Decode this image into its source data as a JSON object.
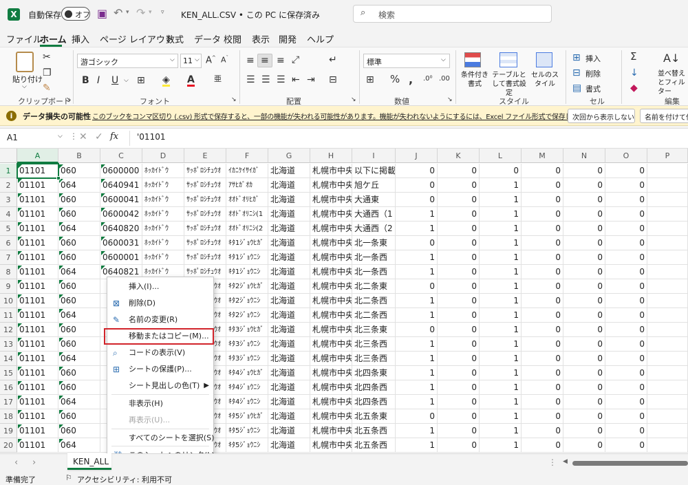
{
  "titlebar": {
    "autosave_label": "自動保存",
    "autosave_state": "オフ",
    "filename": "KEN_ALL.CSV • この PC に保存済み",
    "search_placeholder": "検索"
  },
  "menu": [
    "ファイル",
    "ホーム",
    "挿入",
    "ページ レイアウト",
    "数式",
    "データ",
    "校閲",
    "表示",
    "開発",
    "ヘルプ"
  ],
  "ribbon": {
    "clipboard": {
      "paste": "貼り付け",
      "group": "クリップボード"
    },
    "font": {
      "name": "游ゴシック",
      "size": "11",
      "group": "フォント"
    },
    "alignment": {
      "group": "配置"
    },
    "number": {
      "format": "標準",
      "group": "数値"
    },
    "styles": {
      "cond_format": "条件付き書式",
      "table_format": "テーブルとして書式設定",
      "cell_styles": "セルのスタイル",
      "group": "スタイル"
    },
    "cells": {
      "insert": "挿入",
      "delete": "削除",
      "format": "書式",
      "group": "セル"
    },
    "editing": {
      "sort": "並べ替えとフィルター",
      "group": "編集"
    }
  },
  "message_bar": {
    "title": "データ損失の可能性",
    "text": "このブックをコンマ区切り (.csv) 形式で保存すると、一部の機能が失われる可能性があります。機能が失われないようにするには、Excel ファイル形式で保存してください。",
    "btn_dont_show": "次回から表示しない",
    "btn_save_as": "名前を付けて保"
  },
  "formula_bar": {
    "name_box": "A1",
    "fx": "fx",
    "value": "'01101"
  },
  "columns": [
    "A",
    "B",
    "C",
    "D",
    "E",
    "F",
    "G",
    "H",
    "I",
    "J",
    "K",
    "L",
    "M",
    "N",
    "O",
    "P"
  ],
  "rows": [
    [
      "1",
      "01101",
      "060",
      "0600000",
      "ﾎｯｶｲﾄﾞｳ",
      "ｻｯﾎﾟﾛｼﾁｭｳｵ",
      "ｲｶﾆｹｲｻｲｶﾞ",
      "北海道",
      "札幌市中央",
      "以下に掲載",
      "0",
      "0",
      "0",
      "0",
      "0",
      "0"
    ],
    [
      "2",
      "01101",
      "064",
      "0640941",
      "ﾎｯｶｲﾄﾞｳ",
      "ｻｯﾎﾟﾛｼﾁｭｳｵ",
      "ｱｻﾋｶﾞｵｶ",
      "北海道",
      "札幌市中央",
      "旭ケ丘",
      "0",
      "0",
      "1",
      "0",
      "0",
      "0"
    ],
    [
      "3",
      "01101",
      "060",
      "0600041",
      "ﾎｯｶｲﾄﾞｳ",
      "ｻｯﾎﾟﾛｼﾁｭｳｵ",
      "ｵｵﾄﾞｵﾘﾋｶﾞ",
      "北海道",
      "札幌市中央",
      "大通東",
      "0",
      "0",
      "1",
      "0",
      "0",
      "0"
    ],
    [
      "4",
      "01101",
      "060",
      "0600042",
      "ﾎｯｶｲﾄﾞｳ",
      "ｻｯﾎﾟﾛｼﾁｭｳｵ",
      "ｵｵﾄﾞｵﾘﾆｼ(1",
      "北海道",
      "札幌市中央",
      "大通西（1",
      "1",
      "0",
      "1",
      "0",
      "0",
      "0"
    ],
    [
      "5",
      "01101",
      "064",
      "0640820",
      "ﾎｯｶｲﾄﾞｳ",
      "ｻｯﾎﾟﾛｼﾁｭｳｵ",
      "ｵｵﾄﾞｵﾘﾆｼ(2",
      "北海道",
      "札幌市中央",
      "大通西（2",
      "1",
      "0",
      "1",
      "0",
      "0",
      "0"
    ],
    [
      "6",
      "01101",
      "060",
      "0600031",
      "ﾎｯｶｲﾄﾞｳ",
      "ｻｯﾎﾟﾛｼﾁｭｳｵ",
      "ｷﾀ1ｼﾞｮｳﾋｶﾞ",
      "北海道",
      "札幌市中央",
      "北一条東",
      "0",
      "0",
      "1",
      "0",
      "0",
      "0"
    ],
    [
      "7",
      "01101",
      "060",
      "0600001",
      "ﾎｯｶｲﾄﾞｳ",
      "ｻｯﾎﾟﾛｼﾁｭｳｵ",
      "ｷﾀ1ｼﾞｮｳﾆｼ",
      "北海道",
      "札幌市中央",
      "北一条西",
      "1",
      "0",
      "1",
      "0",
      "0",
      "0"
    ],
    [
      "8",
      "01101",
      "064",
      "0640821",
      "ﾎｯｶｲﾄﾞｳ",
      "ｻｯﾎﾟﾛｼﾁｭｳｵ",
      "ｷﾀ1ｼﾞｮｳﾆｼ",
      "北海道",
      "札幌市中央",
      "北一条西",
      "1",
      "0",
      "1",
      "0",
      "0",
      "0"
    ],
    [
      "9",
      "01101",
      "060",
      "",
      "",
      "ｻｯﾎﾟﾛｼﾁｭｳｵ",
      "ｷﾀ2ｼﾞｮｳﾋｶﾞ",
      "北海道",
      "札幌市中央",
      "北二条東",
      "0",
      "0",
      "1",
      "0",
      "0",
      "0"
    ],
    [
      "10",
      "01101",
      "060",
      "",
      "",
      "ｻｯﾎﾟﾛｼﾁｭｳｵ",
      "ｷﾀ2ｼﾞｮｳﾆｼ",
      "北海道",
      "札幌市中央",
      "北二条西",
      "1",
      "0",
      "1",
      "0",
      "0",
      "0"
    ],
    [
      "11",
      "01101",
      "064",
      "",
      "",
      "ｻｯﾎﾟﾛｼﾁｭｳｵ",
      "ｷﾀ2ｼﾞｮｳﾆｼ",
      "北海道",
      "札幌市中央",
      "北二条西",
      "1",
      "0",
      "1",
      "0",
      "0",
      "0"
    ],
    [
      "12",
      "01101",
      "060",
      "",
      "",
      "ｻｯﾎﾟﾛｼﾁｭｳｵ",
      "ｷﾀ3ｼﾞｮｳﾋｶﾞ",
      "北海道",
      "札幌市中央",
      "北三条東",
      "0",
      "0",
      "1",
      "0",
      "0",
      "0"
    ],
    [
      "13",
      "01101",
      "060",
      "",
      "",
      "ｻｯﾎﾟﾛｼﾁｭｳｵ",
      "ｷﾀ3ｼﾞｮｳﾆｼ",
      "北海道",
      "札幌市中央",
      "北三条西",
      "1",
      "0",
      "1",
      "0",
      "0",
      "0"
    ],
    [
      "14",
      "01101",
      "064",
      "",
      "",
      "ｻｯﾎﾟﾛｼﾁｭｳｵ",
      "ｷﾀ3ｼﾞｮｳﾆｼ",
      "北海道",
      "札幌市中央",
      "北三条西",
      "1",
      "0",
      "1",
      "0",
      "0",
      "0"
    ],
    [
      "15",
      "01101",
      "060",
      "",
      "",
      "ｻｯﾎﾟﾛｼﾁｭｳｵ",
      "ｷﾀ4ｼﾞｮｳﾋｶﾞ",
      "北海道",
      "札幌市中央",
      "北四条東",
      "1",
      "0",
      "1",
      "0",
      "0",
      "0"
    ],
    [
      "16",
      "01101",
      "060",
      "",
      "",
      "ｻｯﾎﾟﾛｼﾁｭｳｵ",
      "ｷﾀ4ｼﾞｮｳﾆｼ",
      "北海道",
      "札幌市中央",
      "北四条西",
      "1",
      "0",
      "1",
      "0",
      "0",
      "0"
    ],
    [
      "17",
      "01101",
      "064",
      "",
      "",
      "ｻｯﾎﾟﾛｼﾁｭｳｵ",
      "ｷﾀ4ｼﾞｮｳﾆｼ",
      "北海道",
      "札幌市中央",
      "北四条西",
      "1",
      "0",
      "1",
      "0",
      "0",
      "0"
    ],
    [
      "18",
      "01101",
      "060",
      "",
      "",
      "ｻｯﾎﾟﾛｼﾁｭｳｵ",
      "ｷﾀ5ｼﾞｮｳﾋｶﾞ",
      "北海道",
      "札幌市中央",
      "北五条東",
      "0",
      "0",
      "1",
      "0",
      "0",
      "0"
    ],
    [
      "19",
      "01101",
      "060",
      "",
      "",
      "ｻｯﾎﾟﾛｼﾁｭｳｵ",
      "ｷﾀ5ｼﾞｮｳﾆｼ",
      "北海道",
      "札幌市中央",
      "北五条西",
      "1",
      "0",
      "1",
      "0",
      "0",
      "0"
    ],
    [
      "20",
      "01101",
      "064",
      "",
      "",
      "ｻｯﾎﾟﾛｼﾁｭｳｵ",
      "ｷﾀ5ｼﾞｮｳﾆｼ",
      "北海道",
      "札幌市中央",
      "北五条西",
      "1",
      "0",
      "1",
      "0",
      "0",
      "0"
    ]
  ],
  "context_menu": [
    {
      "label": "挿入(I)...",
      "icon": "none",
      "enabled": true
    },
    {
      "label": "削除(D)",
      "icon": "delete-sheet-icon",
      "enabled": true
    },
    {
      "label": "名前の変更(R)",
      "icon": "rename-icon",
      "enabled": true
    },
    {
      "label": "移動またはコピー(M)...",
      "icon": "none",
      "enabled": true,
      "highlighted": true
    },
    {
      "label": "コードの表示(V)",
      "icon": "view-code-icon",
      "enabled": true
    },
    {
      "label": "シートの保護(P)...",
      "icon": "protect-sheet-icon",
      "enabled": true
    },
    {
      "label": "シート見出しの色(T)",
      "icon": "none",
      "enabled": true,
      "submenu": true
    },
    {
      "label": "非表示(H)",
      "icon": "none",
      "enabled": true
    },
    {
      "label": "再表示(U)...",
      "icon": "none",
      "enabled": false
    },
    {
      "label": "すべてのシートを選択(S)",
      "icon": "none",
      "enabled": true
    },
    {
      "label": "このシートへのリンク(L)",
      "icon": "link-icon",
      "enabled": true
    }
  ],
  "sheet_tab": "KEN_ALL",
  "status": {
    "ready": "準備完了",
    "accessibility": "アクセシビリティ: 利用不可"
  },
  "colors": {
    "excel_green": "#107c41",
    "highlight_red": "#d1232a",
    "msg_bg": "#fff4ce"
  }
}
